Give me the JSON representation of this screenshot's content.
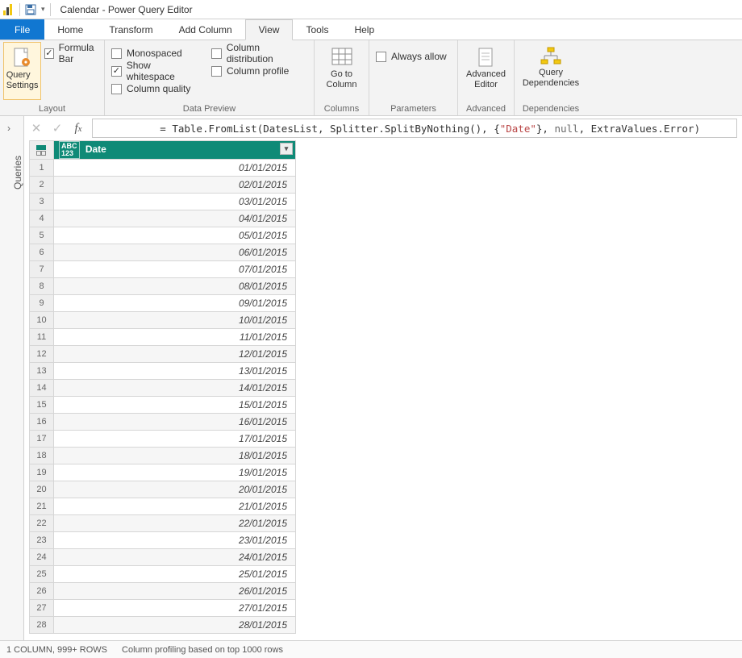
{
  "title": "Calendar - Power Query Editor",
  "menu": {
    "file": "File",
    "home": "Home",
    "transform": "Transform",
    "addColumn": "Add Column",
    "view": "View",
    "tools": "Tools",
    "help": "Help"
  },
  "ribbon": {
    "layout": {
      "label": "Layout",
      "querySettings": "Query\nSettings",
      "formulaBar": "Formula Bar"
    },
    "dataPreview": {
      "label": "Data Preview",
      "monospaced": "Monospaced",
      "showWhitespace": "Show whitespace",
      "columnQuality": "Column quality",
      "columnDistribution": "Column distribution",
      "columnProfile": "Column profile"
    },
    "columns": {
      "label": "Columns",
      "goToColumn": "Go to\nColumn"
    },
    "parameters": {
      "label": "Parameters",
      "alwaysAllow": "Always allow"
    },
    "advanced": {
      "label": "Advanced",
      "advancedEditor": "Advanced\nEditor"
    },
    "dependencies": {
      "label": "Dependencies",
      "queryDependencies": "Query\nDependencies"
    }
  },
  "queriesPane": {
    "label": "Queries"
  },
  "formula": {
    "prefix": "= ",
    "fn1": "Table.FromList",
    "open": "(DatesList, ",
    "fn2": "Splitter.SplitByNothing",
    "afterFn2": "(), {",
    "str": "\"Date\"",
    "afterStr": "}, ",
    "null": "null",
    "afterNull": ", ",
    "fn3": "ExtraValues.Error",
    "close": ")"
  },
  "table": {
    "columnType": "ABC\n123",
    "columnName": "Date",
    "rows": [
      "01/01/2015",
      "02/01/2015",
      "03/01/2015",
      "04/01/2015",
      "05/01/2015",
      "06/01/2015",
      "07/01/2015",
      "08/01/2015",
      "09/01/2015",
      "10/01/2015",
      "11/01/2015",
      "12/01/2015",
      "13/01/2015",
      "14/01/2015",
      "15/01/2015",
      "16/01/2015",
      "17/01/2015",
      "18/01/2015",
      "19/01/2015",
      "20/01/2015",
      "21/01/2015",
      "22/01/2015",
      "23/01/2015",
      "24/01/2015",
      "25/01/2015",
      "26/01/2015",
      "27/01/2015",
      "28/01/2015"
    ]
  },
  "status": {
    "columns": "1 COLUMN, 999+ ROWS",
    "profiling": "Column profiling based on top 1000 rows"
  }
}
